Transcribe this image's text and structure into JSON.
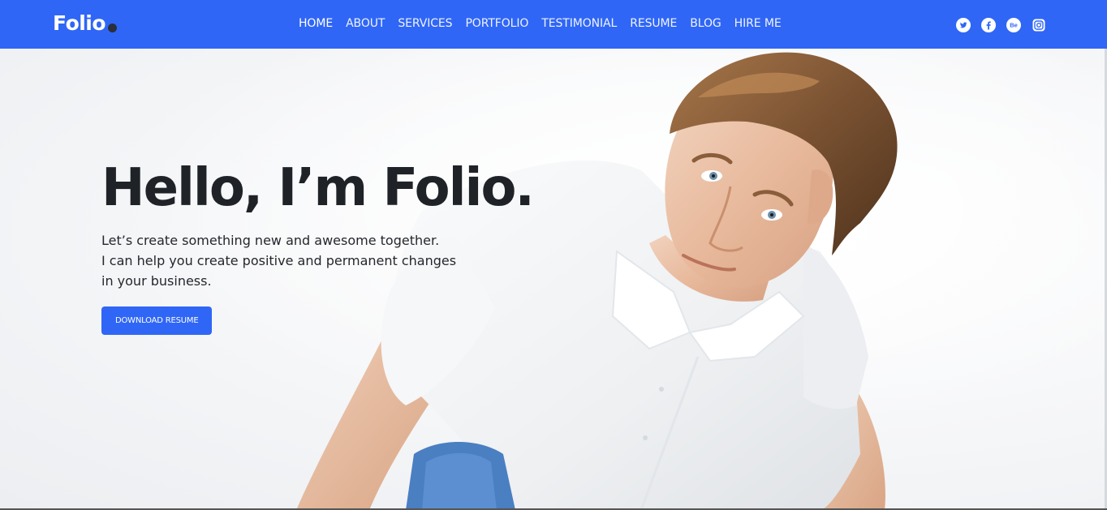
{
  "header": {
    "logo": "Folio",
    "nav": [
      {
        "label": "HOME"
      },
      {
        "label": "ABOUT"
      },
      {
        "label": "SERVICES"
      },
      {
        "label": "PORTFOLIO"
      },
      {
        "label": "TESTIMONIAL"
      },
      {
        "label": "RESUME"
      },
      {
        "label": "BLOG"
      },
      {
        "label": "HIRE ME"
      }
    ],
    "social": [
      {
        "icon": "twitter-icon",
        "glyph": ""
      },
      {
        "icon": "facebook-icon",
        "glyph": ""
      },
      {
        "icon": "behance-icon",
        "glyph": "Be"
      },
      {
        "icon": "instagram-icon",
        "glyph": ""
      }
    ]
  },
  "hero": {
    "title": "Hello, I’m Folio.",
    "subtitle_lines": [
      "Let’s create something new and awesome together.",
      "I can help you create positive and permanent changes",
      "in your business."
    ],
    "cta_label": "DOWNLOAD RESUME"
  },
  "colors": {
    "brand": "#2f66f6",
    "heading": "#1f2328",
    "body_text": "#24272c"
  }
}
